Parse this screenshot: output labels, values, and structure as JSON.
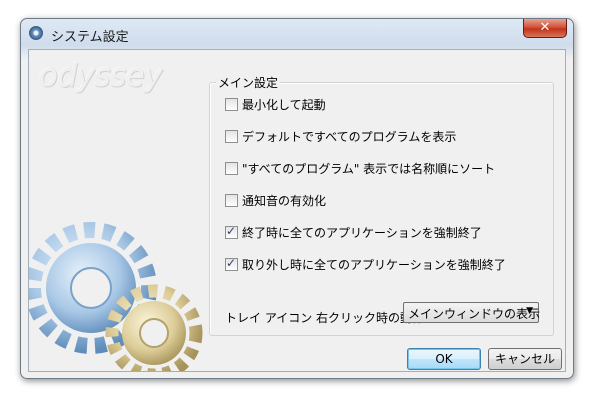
{
  "window": {
    "title": "システム設定",
    "close_glyph": "✕"
  },
  "brand": {
    "logo_text": "odyssey"
  },
  "main_settings": {
    "legend": "メイン設定",
    "options": [
      {
        "label": "最小化して起動",
        "checked": false
      },
      {
        "label": "デフォルトですべてのプログラムを表示",
        "checked": false
      },
      {
        "label": "\"すべてのプログラム\" 表示では名称順にソート",
        "checked": false
      },
      {
        "label": "通知音の有効化",
        "checked": false
      },
      {
        "label": "終了時に全てのアプリケーションを強制終了",
        "checked": true
      },
      {
        "label": "取り外し時に全てのアプリケーションを強制終了",
        "checked": true
      }
    ],
    "tray_action_label": "トレイ アイコン 右クリック時の動作",
    "tray_action_value": "メインウィンドウの表示"
  },
  "buttons": {
    "ok": "OK",
    "cancel": "キャンセル"
  },
  "colors": {
    "gear_blue": "#8fb8de",
    "gear_gold": "#d8c78e",
    "close_red": "#c94a30"
  }
}
